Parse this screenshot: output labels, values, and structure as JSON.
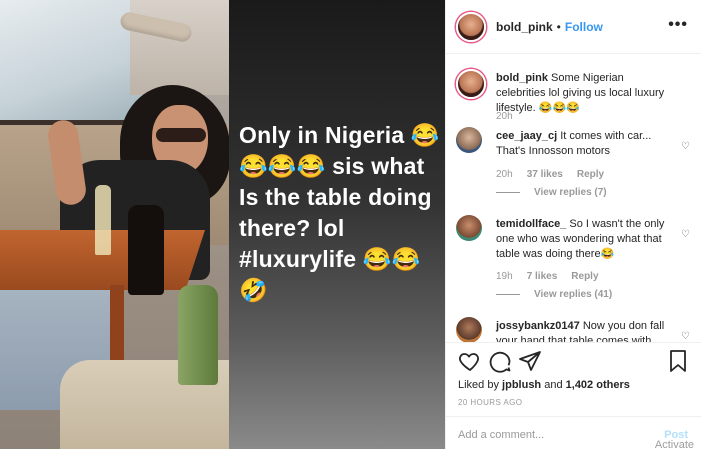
{
  "media": {
    "overlay_text": "Only in Nigeria 😂 😂😂😂 sis what Is the table doing there? lol #luxurylife 😂😂🤣"
  },
  "header": {
    "username": "bold_pink",
    "separator": "•",
    "follow_label": "Follow",
    "more_icon": "more-horizontal-icon"
  },
  "caption": {
    "username": "bold_pink",
    "text": "Some Nigerian celebrities lol giving us local luxury lifestyle. 😂😂😂",
    "time": "20h"
  },
  "comments": [
    {
      "username": "cee_jaay_cj",
      "text": "It comes with car... That's Innosson motors",
      "time": "20h",
      "likes": "37 likes",
      "reply": "Reply",
      "view_replies": "View replies (7)"
    },
    {
      "username": "temidollface_",
      "text": "So I wasn't the only one who was wondering what that table was doing there😂",
      "time": "19h",
      "likes": "7 likes",
      "reply": "Reply",
      "view_replies": "View replies (41)"
    },
    {
      "username": "jossybankz0147",
      "text": "Now you don fall your hand that table comes with"
    }
  ],
  "actions": {
    "liked_by_prefix": "Liked by",
    "liked_by_user": "jpblush",
    "liked_by_and": "and",
    "liked_by_others": "1,402 others",
    "timestamp": "20 HOURS AGO"
  },
  "add_comment": {
    "placeholder": "Add a comment...",
    "post_label": "Post",
    "watermark": "Activate"
  },
  "colors": {
    "accent": "#3897f0",
    "muted": "#999999"
  }
}
